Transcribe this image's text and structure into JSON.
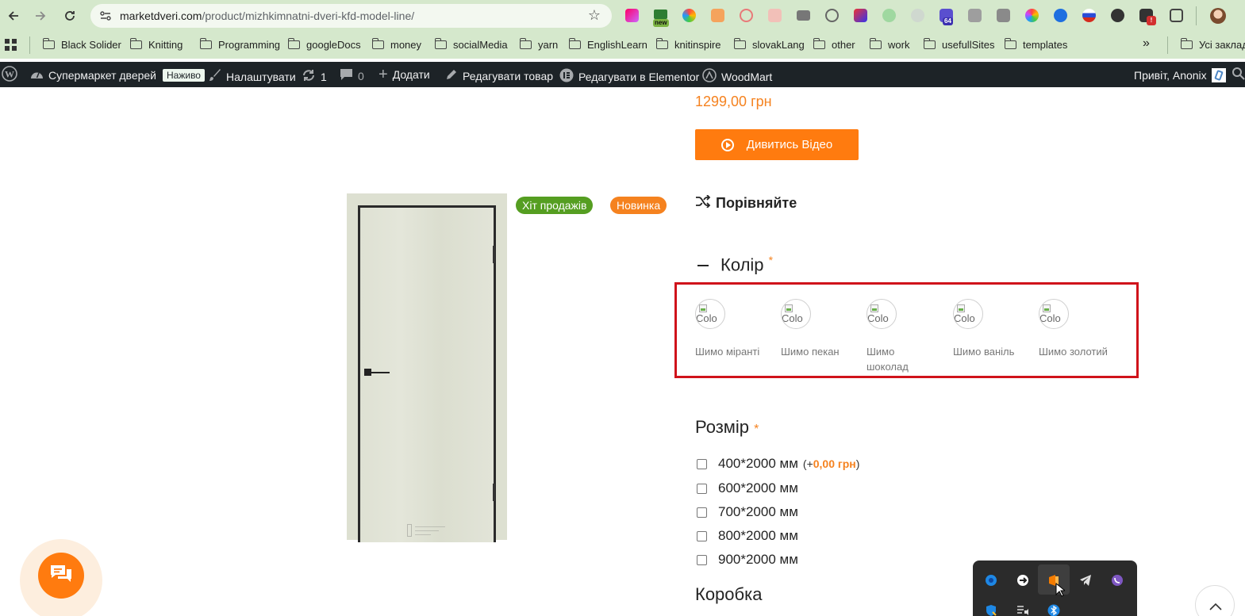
{
  "browser": {
    "url_host": "marketdveri.com",
    "url_path": "/product/mizhkimnatni-dveri-kfd-model-line/",
    "ext_badge_new": "new",
    "ext_badge_64": "64",
    "ext_badge_alert": "!",
    "more_glyph": "»",
    "all_bookmarks": "Усі заклад"
  },
  "bookmarks": [
    "Black Solider",
    "Knitting",
    "Programming",
    "googleDocs",
    "money",
    "socialMedia",
    "yarn",
    "EnglishLearn",
    "knitinspire",
    "slovakLang",
    "other",
    "work",
    "usefullSites",
    "templates"
  ],
  "adminbar": {
    "site_name": "Супермаркет дверей",
    "live_badge": "Наживо",
    "customize": "Налаштувати",
    "updates_count": "1",
    "comments_count": "0",
    "add_new": "Додати",
    "edit_product": "Редагувати товар",
    "edit_elementor": "Редагувати в Elementor",
    "woodmart": "WoodMart",
    "greeting": "Привіт, Anonix"
  },
  "product": {
    "price": "1299,00 грн",
    "video_button": "Дивитись Відео",
    "badges": {
      "hit": "Хіт продажів",
      "new": "Новинка"
    },
    "compare": "Порівняйте",
    "color_title": "Колір",
    "required_mark": "*",
    "swatch_alt": "Colo",
    "colors": [
      {
        "label": "Шимо міранті"
      },
      {
        "label": "Шимо пекан"
      },
      {
        "label": "Шимо шоколад"
      },
      {
        "label": "Шимо ваніль"
      },
      {
        "label": "Шимо золотий"
      }
    ],
    "size_title": "Розмір",
    "sizes": [
      {
        "label": "400*2000 мм",
        "extra_prefix": "(+",
        "extra_price": "0,00 грн",
        "extra_suffix": ")"
      },
      {
        "label": "600*2000 мм"
      },
      {
        "label": "700*2000 мм"
      },
      {
        "label": "800*2000 мм"
      },
      {
        "label": "900*2000 мм"
      }
    ],
    "box_title": "Коробка"
  },
  "colors": {
    "accent": "#ff7b0f",
    "price": "#f5821f",
    "hit_badge": "#559e21",
    "highlight_border": "#d0131b",
    "admin_bar": "#1d2327",
    "browser_chrome": "#d5e8cc"
  }
}
